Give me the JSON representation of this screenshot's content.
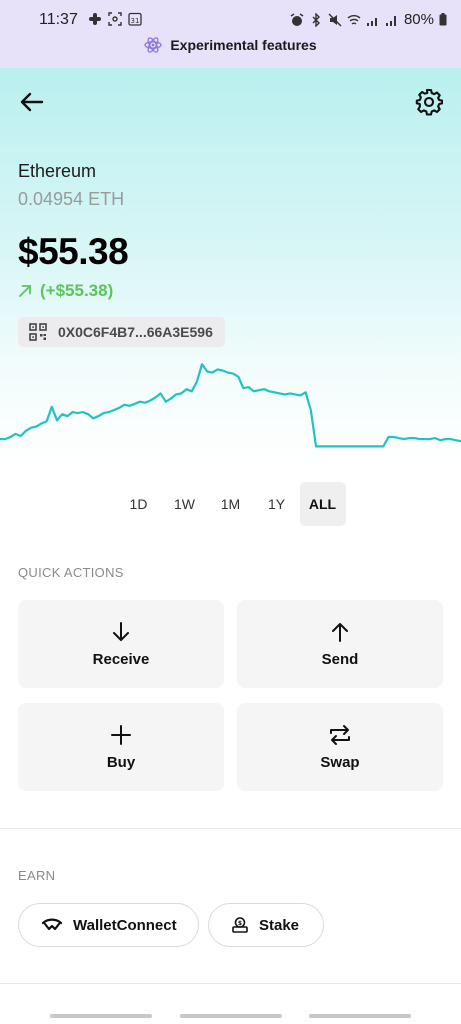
{
  "status_bar": {
    "time": "11:37",
    "battery": "80%",
    "banner": "Experimental features"
  },
  "asset": {
    "name": "Ethereum",
    "amount": "0.04954 ETH",
    "balance": "$55.38",
    "change": "(+$55.38)",
    "address": "0X0C6F4B7...66A3E596"
  },
  "chart_data": {
    "type": "line",
    "color": "#22c1c3",
    "y": [
      22,
      22,
      24,
      27,
      25,
      30,
      33,
      34,
      37,
      39,
      53,
      40,
      46,
      44,
      48,
      47,
      48,
      46,
      42,
      44,
      47,
      48,
      50,
      52,
      55,
      54,
      56,
      58,
      57,
      59,
      62,
      66,
      58,
      61,
      65,
      66,
      70,
      68,
      77,
      94,
      87,
      86,
      89,
      88,
      86,
      85,
      82,
      71,
      72,
      68,
      69,
      70,
      68,
      67,
      66,
      65,
      66,
      65,
      64,
      67,
      50,
      15,
      15,
      15,
      15,
      15,
      15,
      15,
      15,
      15,
      15,
      15,
      15,
      15,
      15,
      24,
      24,
      23,
      22,
      23,
      23,
      22,
      22,
      22,
      23,
      21,
      22,
      22,
      21,
      20
    ]
  },
  "ranges": [
    "1D",
    "1W",
    "1M",
    "1Y",
    "ALL"
  ],
  "active_range": "ALL",
  "quick_actions": {
    "title": "QUICK ACTIONS",
    "receive": "Receive",
    "send": "Send",
    "buy": "Buy",
    "swap": "Swap"
  },
  "earn": {
    "title": "EARN",
    "walletconnect": "WalletConnect",
    "stake": "Stake"
  }
}
